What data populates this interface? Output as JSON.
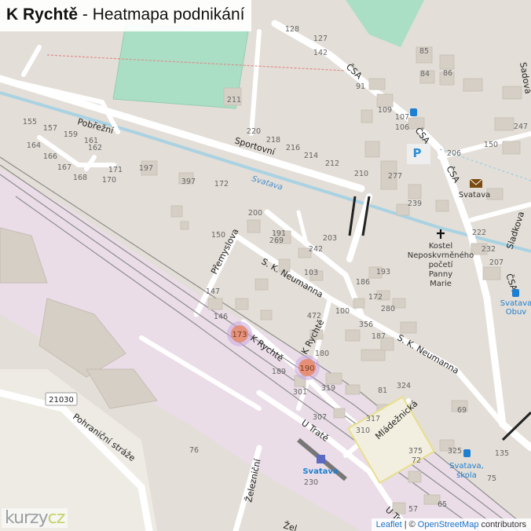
{
  "title": {
    "place": "K Rychtě",
    "suffix": "- Heatmapa podnikání"
  },
  "attribution": {
    "leaflet": "Leaflet",
    "separator": "|",
    "copyright": "©",
    "osm": "OpenStreetMap",
    "contributors": "contributors"
  },
  "logo": {
    "main": "kurzy",
    "accent": "cz"
  },
  "streets": {
    "pobrezni": "Pobřežní",
    "sportovni": "Sportovní",
    "csa_top": "ČSA",
    "csa_mid": "ČSA",
    "csa_right": "ČSA",
    "csa_far": "ČSA",
    "premyslova": "Přemyslova",
    "neumanna": "S. K. Neumanna",
    "neumanna_2": "S. K. Neumanna",
    "k_rychte": "K Rychtě",
    "k_rychte_2": "K Rychtě",
    "mladeznicka": "Mládežnická",
    "u_trate": "U Tratě",
    "u_trate_2": "U Tr",
    "pohranicni": "Pohraniční stráže",
    "zeleznicni": "Železniční",
    "zel_bottom": "Žel",
    "sladkova": "Sladkova",
    "sadova": "Sadová"
  },
  "water": {
    "svatava": "Svatava"
  },
  "road_shield": "21030",
  "pois": {
    "church": "Kostel Neposkvrněného početí Panny Marie",
    "church_lines": [
      "Kostel",
      "Neposkvrněného",
      "početí",
      "Panny",
      "Marie"
    ],
    "post_office": "Svatava",
    "station": "Svatava",
    "bus_obuv_lines": [
      "Svatava",
      "Obuv"
    ],
    "bus_skola_lines": [
      "Svatava,",
      "škola"
    ],
    "parking": "P"
  },
  "heatmap": [
    {
      "label": "173",
      "intensity": 0.6
    },
    {
      "label": "190",
      "intensity": 0.8
    }
  ],
  "house_numbers": [
    "128",
    "127",
    "142",
    "85",
    "84",
    "86",
    "91",
    "211",
    "109",
    "107",
    "106",
    "220",
    "218",
    "216",
    "214",
    "212",
    "210",
    "155",
    "157",
    "159",
    "161",
    "164",
    "162",
    "166",
    "167",
    "171",
    "168",
    "170",
    "197",
    "397",
    "172",
    "200",
    "191",
    "269",
    "242",
    "203",
    "150",
    "103",
    "147",
    "193",
    "186",
    "172",
    "146",
    "472",
    "100",
    "280",
    "356",
    "187",
    "180",
    "189",
    "301",
    "319",
    "324",
    "307",
    "310",
    "317",
    "81",
    "69",
    "72",
    "375",
    "76",
    "230",
    "206",
    "150",
    "247",
    "277",
    "239",
    "222",
    "232",
    "207",
    "75",
    "325",
    "135",
    "57",
    "65"
  ],
  "colors": {
    "heat_core": "#e8896a",
    "heat_halo": "#c9a8e0",
    "rail_zone": "#eadde7",
    "river": "#a9d2e3",
    "pitch": "#aadfc5",
    "road": "#ffffff",
    "building": "#d6cfc6",
    "title_bg": "#ffffff"
  }
}
